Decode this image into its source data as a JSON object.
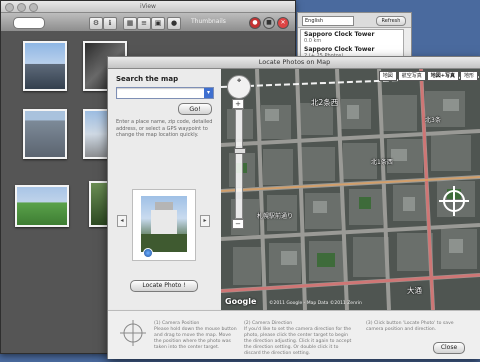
{
  "back_window": {
    "title": "iView",
    "toolbar_label": "Thumbnails"
  },
  "info_panel": {
    "language": "English",
    "refresh_label": "Refresh",
    "items": [
      {
        "title": "Sapporo Clock Tower",
        "detail": "0.0 km"
      },
      {
        "title": "Sapporo Clock Tower",
        "detail": "2 (+ 25 Photos)"
      }
    ]
  },
  "dialog": {
    "title": "Locate Photos on Map",
    "search_label": "Search the map",
    "search_value": "",
    "go_label": "Go!",
    "help_text": "Enter a place name, zip code, detailed address, or select a GPS waypoint to change the map location quickly.",
    "prev_label": "◂",
    "next_label": "▸",
    "locate_label": "Locate Photo !",
    "close_label": "Close",
    "map_types": [
      {
        "label": "地図",
        "active": false
      },
      {
        "label": "航空写真",
        "active": false
      },
      {
        "label": "地図+写真",
        "active": true
      },
      {
        "label": "地形",
        "active": false
      }
    ],
    "map_labels": {
      "district": "北2条西",
      "road": "札幌駅前通り",
      "station_area": "大通",
      "sub1": "北1条西",
      "sub2": "北3条"
    },
    "map_logo": "Google",
    "map_copyright": "©2011 Google - Map Data ©2011 Zenrin",
    "tips": [
      {
        "head": "(1) Camera Position",
        "body": "Please hold down the mouse button and drag to move the map. Move the position where the photo was taken into the center target."
      },
      {
        "head": "(2) Camera Direction",
        "body": "If you'd like to set the camera direction for the photo, please click the center target to begin the direction adjusting. Click it again to accept the direction setting. Or double click it to discard the direction setting."
      },
      {
        "head": "(3) Click button 'Locate Photo' to save camera position and direction.",
        "body": ""
      }
    ]
  },
  "colors": {
    "desktop": "#4a6a9e",
    "map_bg": "#4e5450",
    "accent": "#3e6fd0"
  }
}
